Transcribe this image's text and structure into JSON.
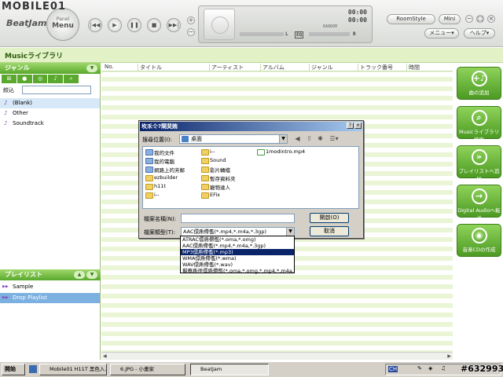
{
  "watermark": "MOBILE01",
  "stamp": "#632993",
  "app": {
    "logo": "BeatJam",
    "menu_small": "Panel",
    "menu_label": "Menu",
    "display": {
      "time_top": "00:00",
      "time_bottom": "00:00",
      "left_label": "L",
      "eq_label": "EQ",
      "right_label": "R",
      "random_label": "RANDOM"
    },
    "roomstyle_label": "RoomStyle",
    "mini_label": "Mini",
    "menu_dropdown": "メニュー▾",
    "help_dropdown": "ヘルプ▾"
  },
  "library_title": "Musicライブラリ",
  "sidebar": {
    "genre_header": "ジャンル",
    "filter_label": "絞込",
    "genres": [
      "(Blank)",
      "Other",
      "Soundtrack"
    ],
    "playlist_header": "プレイリスト",
    "playlists": [
      "Sample",
      "Drop Playlist"
    ]
  },
  "columns": [
    "No.",
    "タイトル",
    "アーティスト",
    "アルバム",
    "ジャンル",
    "トラック番号",
    "時間"
  ],
  "right_buttons": [
    "曲の追加",
    "Musicライブラリ検索",
    "プレイリストへ追加",
    "Digital Audioへ転送",
    "音楽CDの作成"
  ],
  "dialog": {
    "title": "坆乑仒?閛奜姷",
    "look_in_label": "搜尋位置(I):",
    "look_in_value": "桌面",
    "files_col1": [
      "我的文件",
      "我的電腦",
      "網路上的芳鄰",
      "ezbuilder",
      "h11t",
      "i--"
    ],
    "files_col2": [
      "i--",
      "Sound",
      "影片轉檔",
      "暫存資料夾",
      "寵物達人",
      "EFix"
    ],
    "files_col3": [
      "1modintro.mp4"
    ],
    "filename_label": "檔案名稱(N):",
    "filename_value": "",
    "filetype_label": "檔案類型(T):",
    "filetype_value": "AAC僄乕僀儖(*.mp4,*.m4a,*.3gp)",
    "open_button": "開啟(O)",
    "cancel_button": "取消",
    "filetype_options": [
      "ATRAC僄乕僀儖(*.oma,*.omg)",
      "AAC僄乕僀儖(*.mp4,*.m4a,*.3gp)",
      "MP3僄乕僀儖(*.mp3)",
      "WMA僄乕僀儖(*.wma)",
      "WAV僄乕僀儖(*.wav)",
      "擬應乕徑僄乕僀儖(*.oma,*.omg,*.mp4,*.m4a,*"
    ],
    "highlighted_index": 2
  },
  "taskbar": {
    "start": "開始",
    "tasks": [
      "Mobile01 H11T 黑色入...",
      "6.JPG - 小畫家",
      "BeatJam"
    ],
    "tray_lang": "CH"
  }
}
